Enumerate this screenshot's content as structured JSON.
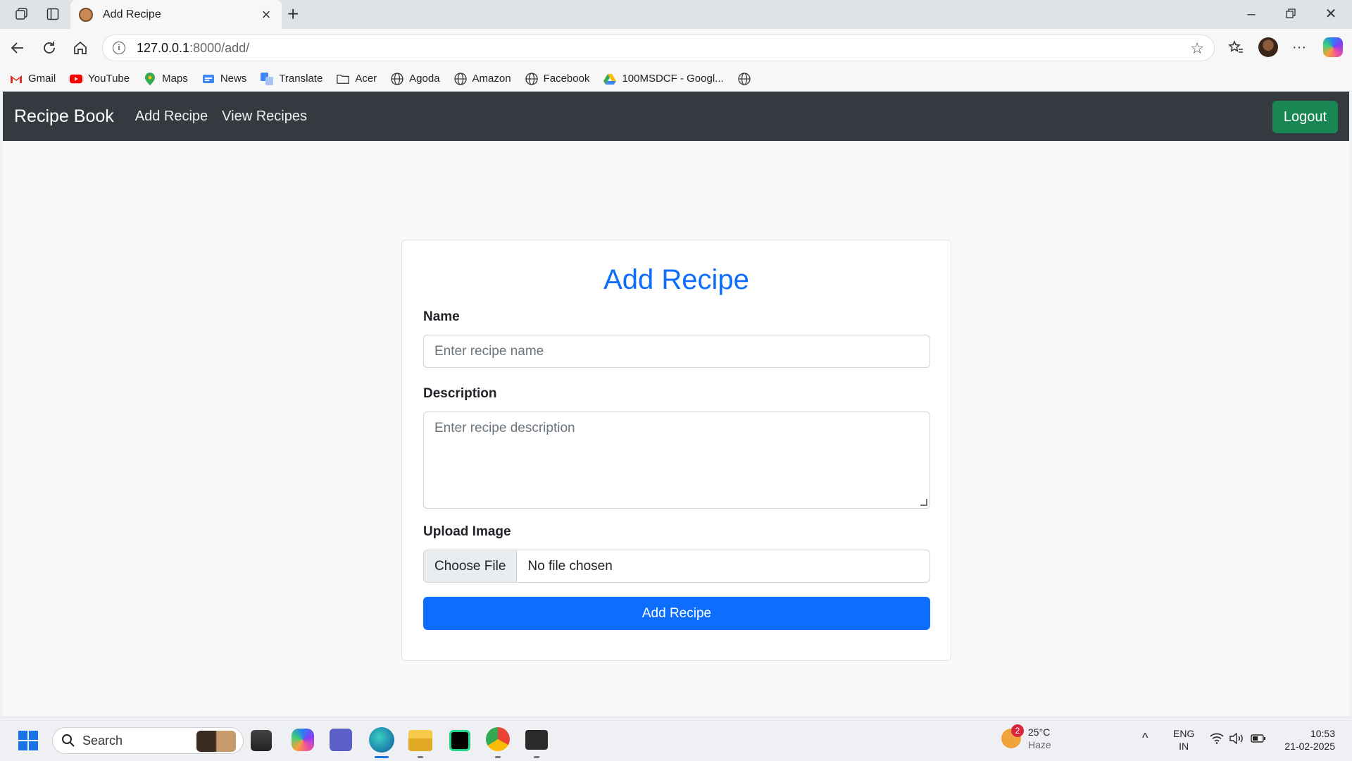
{
  "browser": {
    "tab_title": "Add Recipe",
    "url_host": "127.0.0.1",
    "url_path": ":8000/add/",
    "bookmarks": [
      {
        "label": "Gmail",
        "icon": "gmail-icon"
      },
      {
        "label": "YouTube",
        "icon": "youtube-icon"
      },
      {
        "label": "Maps",
        "icon": "maps-icon"
      },
      {
        "label": "News",
        "icon": "news-icon"
      },
      {
        "label": "Translate",
        "icon": "translate-icon"
      },
      {
        "label": "Acer",
        "icon": "folder-icon"
      },
      {
        "label": "Agoda",
        "icon": "globe-icon"
      },
      {
        "label": "Amazon",
        "icon": "globe-icon"
      },
      {
        "label": "Facebook",
        "icon": "globe-icon"
      },
      {
        "label": "100MSDCF - Googl...",
        "icon": "drive-icon"
      }
    ]
  },
  "navbar": {
    "brand": "Recipe Book",
    "links": [
      "Add Recipe",
      "View Recipes"
    ],
    "logout": "Logout"
  },
  "form": {
    "title": "Add Recipe",
    "name_label": "Name",
    "name_placeholder": "Enter recipe name",
    "description_label": "Description",
    "description_placeholder": "Enter recipe description",
    "image_label": "Upload Image",
    "choose_file": "Choose File",
    "no_file": "No file chosen",
    "submit": "Add Recipe"
  },
  "taskbar": {
    "search_label": "Search",
    "weather_badge": "2",
    "temperature": "25°C",
    "weather_desc": "Haze",
    "lang_line1": "ENG",
    "lang_line2": "IN",
    "time": "10:53",
    "date": "21-02-2025"
  },
  "colors": {
    "primary": "#0d6efd",
    "success": "#198754",
    "navbar": "#343a40"
  }
}
